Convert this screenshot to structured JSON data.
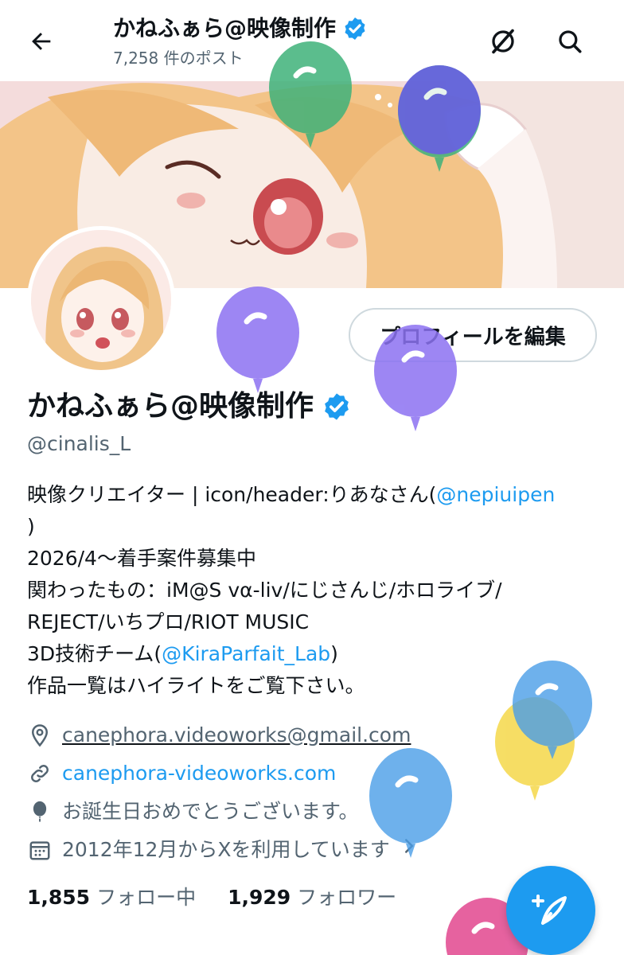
{
  "topbar": {
    "back_icon": "arrow-left-icon",
    "title": "かねふぁら@映像制作",
    "post_count": "7,258 件のポスト",
    "grok_icon": "grok-icon",
    "search_icon": "search-icon"
  },
  "profile": {
    "display_name": "かねふぁら@映像制作",
    "verified_icon": "verified-badge-icon",
    "handle": "@cinalis_L",
    "edit_button": "プロフィールを編集"
  },
  "bio": {
    "line1_text": "映像クリエイター | icon/header:りあなさん(",
    "line1_link": "@nepiuipen",
    "line2": ")",
    "line3": "2026/4〜着手案件募集中",
    "line4": "関わったもの：iM@S vα-liv/にじさんじ/ホロライブ/",
    "line5": "REJECT/いちプロ/RIOT MUSIC",
    "line6_text": "3D技術チーム(",
    "line6_link": "@KiraParfait_Lab",
    "line6_end": ")",
    "line7": "作品一覧はハイライトをご覧下さい。"
  },
  "meta": {
    "email": "canephora.videoworks@gmail.com",
    "website": "canephora-videoworks.com",
    "birthday": "お誕生日おめでとうございます。",
    "joined": "2012年12月からXを利用しています",
    "icons": [
      "location-pin-icon",
      "link-icon",
      "balloon-icon",
      "calendar-icon",
      "chevron-right-icon"
    ]
  },
  "stats": {
    "following_count": "1,855",
    "following_label": "フォロー中",
    "followers_count": "1,929",
    "followers_label": "フォロワー"
  },
  "fab": {
    "icon": "compose-post-icon"
  },
  "colors": {
    "accent": "#1d9bf0",
    "text": "#0f1419",
    "secondary": "#536471",
    "border": "#cfd9de"
  }
}
